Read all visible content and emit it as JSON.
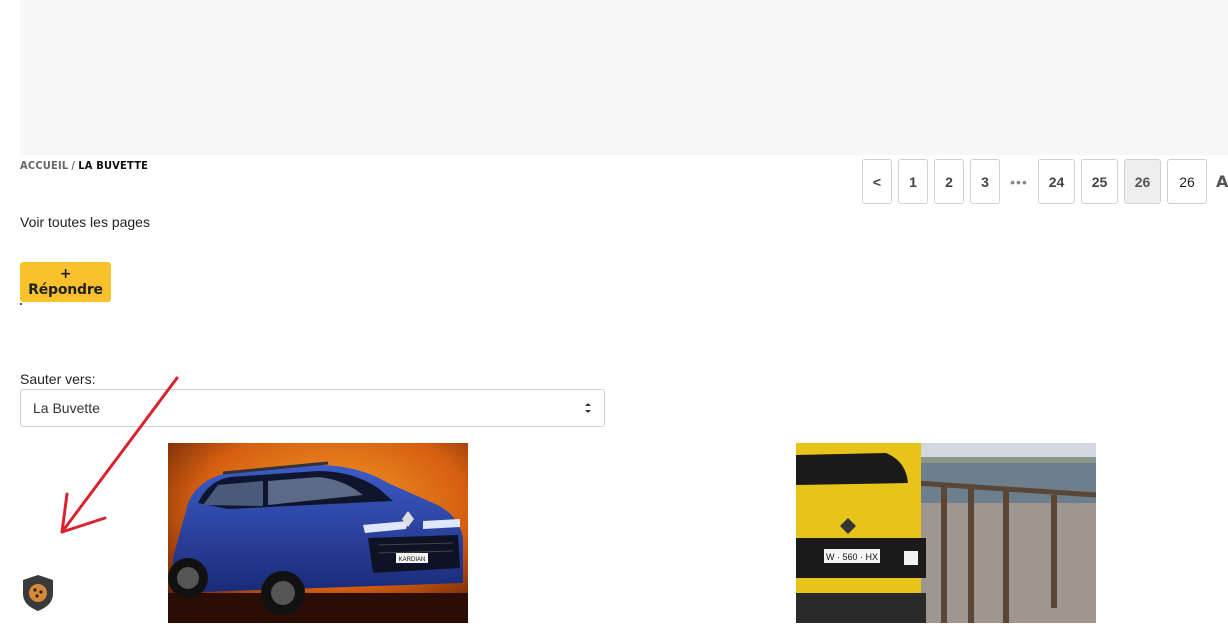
{
  "breadcrumb": {
    "home": "ACCUEIL",
    "separator": "/",
    "current": "LA BUVETTE"
  },
  "pagination": {
    "prev": "<",
    "pages": [
      "1",
      "2",
      "3"
    ],
    "ellipsis": "•••",
    "pages_end": [
      "24",
      "25",
      "26"
    ],
    "current_page": "26",
    "input_value": "26",
    "go_label": "Alle"
  },
  "all_pages_link": "Voir toutes les pages",
  "reply_button": "+ Répondre",
  "jump": {
    "label": "Sauter vers:",
    "selected": "La Buvette"
  },
  "images": {
    "left_badge": "KARDIAN",
    "right_plate": "W · 560 · HX"
  },
  "colors": {
    "accent": "#f9c12b",
    "annotation": "#d9232e"
  },
  "icons": {
    "cookie": "cookie-shield-icon",
    "select_arrow": "sort-chevrons-icon"
  }
}
